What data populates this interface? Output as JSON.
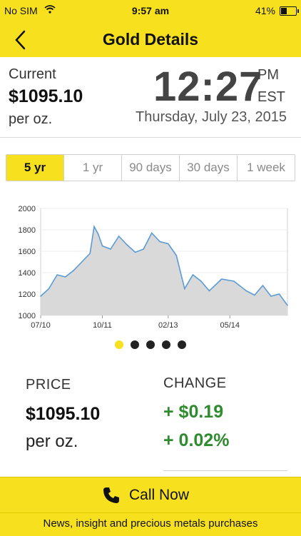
{
  "status": {
    "carrier": "No SIM",
    "time": "9:57 am",
    "battery": "41%"
  },
  "nav": {
    "title": "Gold Details"
  },
  "quote": {
    "current_label": "Current",
    "price": "$1095.10",
    "unit": "per oz.",
    "time": "12:27",
    "ampm": "PM",
    "zone": "EST",
    "date": "Thursday, July 23, 2015"
  },
  "tabs": [
    {
      "label": "5 yr",
      "active": true
    },
    {
      "label": "1 yr",
      "active": false
    },
    {
      "label": "90 days",
      "active": false
    },
    {
      "label": "30 days",
      "active": false
    },
    {
      "label": "1 week",
      "active": false
    }
  ],
  "pager": {
    "count": 5,
    "active_index": 0
  },
  "details": {
    "price_label": "PRICE",
    "price_value": "$1095.10",
    "price_unit": "per oz.",
    "change_label": "CHANGE",
    "change_abs": "+ $0.19",
    "change_pct": "+ 0.02%"
  },
  "actions": {
    "call_label": "Call Now",
    "phone_icon": "phone-icon"
  },
  "footer": {
    "text": "News, insight and precious metals purchases"
  },
  "colors": {
    "accent": "#f7e11f",
    "positive": "#2e8b2e",
    "series_line": "#5b9bd5",
    "series_fill": "#d9d9d9"
  },
  "chart_data": {
    "type": "area",
    "title": "",
    "xlabel": "",
    "ylabel": "",
    "ylim": [
      1000,
      2000
    ],
    "yticks": [
      1000,
      1200,
      1400,
      1600,
      1800,
      2000
    ],
    "xticks": [
      "07/10",
      "10/11",
      "02/13",
      "05/14"
    ],
    "series": [
      {
        "x": [
          "2010-07",
          "2010-09",
          "2010-11",
          "2011-01",
          "2011-03",
          "2011-05",
          "2011-07",
          "2011-08",
          "2011-09",
          "2011-10",
          "2011-12",
          "2012-02",
          "2012-04",
          "2012-06",
          "2012-08",
          "2012-10",
          "2012-12",
          "2013-02",
          "2013-04",
          "2013-06",
          "2013-08",
          "2013-10",
          "2013-12",
          "2014-03",
          "2014-06",
          "2014-09",
          "2014-11",
          "2015-01",
          "2015-03",
          "2015-05",
          "2015-07"
        ],
        "values": [
          1180,
          1250,
          1380,
          1360,
          1420,
          1500,
          1580,
          1830,
          1760,
          1650,
          1620,
          1740,
          1660,
          1590,
          1620,
          1770,
          1690,
          1670,
          1560,
          1250,
          1380,
          1320,
          1230,
          1340,
          1320,
          1230,
          1190,
          1280,
          1180,
          1200,
          1095
        ]
      }
    ]
  }
}
